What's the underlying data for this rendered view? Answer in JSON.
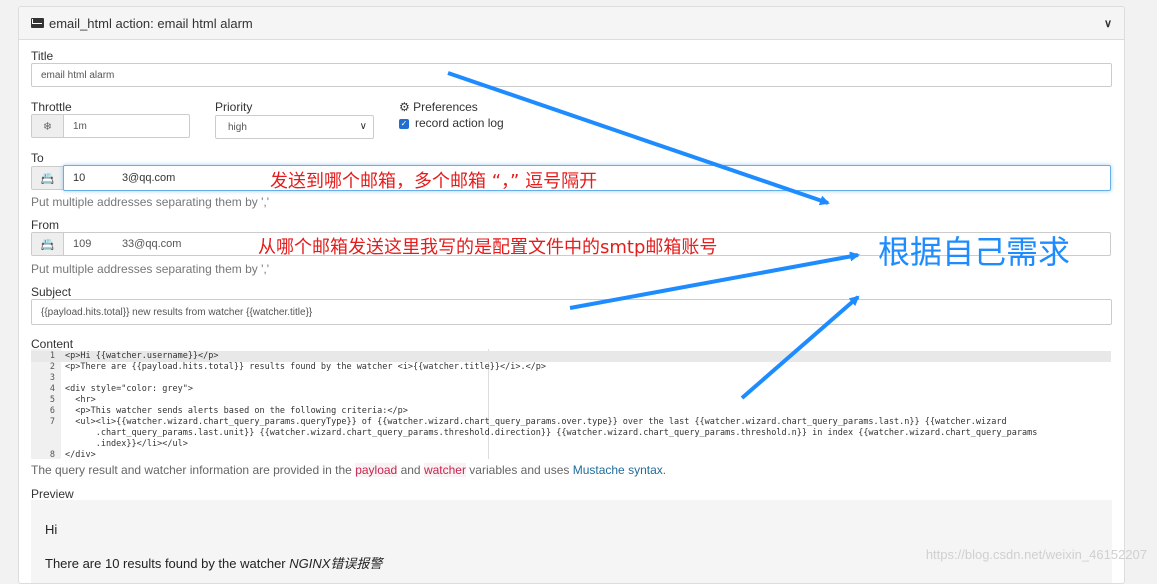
{
  "header": {
    "title": "email_html action: email html alarm"
  },
  "form": {
    "title_label": "Title",
    "title_value": "email html alarm",
    "throttle_label": "Throttle",
    "throttle_value": "1m",
    "priority_label": "Priority",
    "priority_value": "high",
    "preferences_label": "Preferences",
    "record_log_label": "record action log",
    "to_label": "To",
    "to_value": "10⁠      3@qq.com",
    "to_help": "Put multiple addresses separating them by ','",
    "from_label": "From",
    "from_value": "109     33@qq.com",
    "from_help": "Put multiple addresses separating them by ','",
    "subject_label": "Subject",
    "subject_value": "{{payload.hits.total}} new results from watcher {{watcher.title}}",
    "content_label": "Content"
  },
  "code_lines": [
    {
      "n": "1",
      "t": "<p>Hi {{watcher.username}}</p>"
    },
    {
      "n": "2",
      "t": "<p>There are {{payload.hits.total}} results found by the watcher <i>{{watcher.title}}</i>.</p>"
    },
    {
      "n": "3",
      "t": ""
    },
    {
      "n": "4",
      "t": "<div style=\"color: grey\">"
    },
    {
      "n": "5",
      "t": "  <hr>"
    },
    {
      "n": "6",
      "t": "  <p>This watcher sends alerts based on the following criteria:</p>"
    },
    {
      "n": "7",
      "t": "  <ul><li>{{watcher.wizard.chart_query_params.queryType}} of {{watcher.wizard.chart_query_params.over.type}} over the last {{watcher.wizard.chart_query_params.last.n}} {{watcher.wizard"
    },
    {
      "n": "",
      "t": "      .chart_query_params.last.unit}} {{watcher.wizard.chart_query_params.threshold.direction}} {{watcher.wizard.chart_query_params.threshold.n}} in index {{watcher.wizard.chart_query_params"
    },
    {
      "n": "",
      "t": "      .index}}</li></ul>"
    },
    {
      "n": "8",
      "t": "</div>"
    }
  ],
  "content_help": {
    "pre": "The query result and watcher information are provided in the ",
    "payload": "payload",
    "and": " and ",
    "watcher": "watcher",
    "mid": " variables and uses ",
    "mustache": "Mustache syntax",
    "end": "."
  },
  "preview": {
    "label": "Preview",
    "line1": "Hi",
    "line2_pre": "There are 10 results found by the watcher ",
    "line2_em": "NGINX错误报警"
  },
  "annotations": {
    "to_note": "发送到哪个邮箱，多个邮箱 “，” 逗号隔开",
    "from_note": "从哪个邮箱发送这里我写的是配置文件中的smtp邮箱账号",
    "needs_note": "根据自己需求"
  },
  "watermark": "https://blog.csdn.net/weixin_46152207",
  "colors": {
    "annotation_red": "#e51c1c",
    "annotation_blue": "#1e8cff",
    "checkbox": "#1e6fd1"
  }
}
